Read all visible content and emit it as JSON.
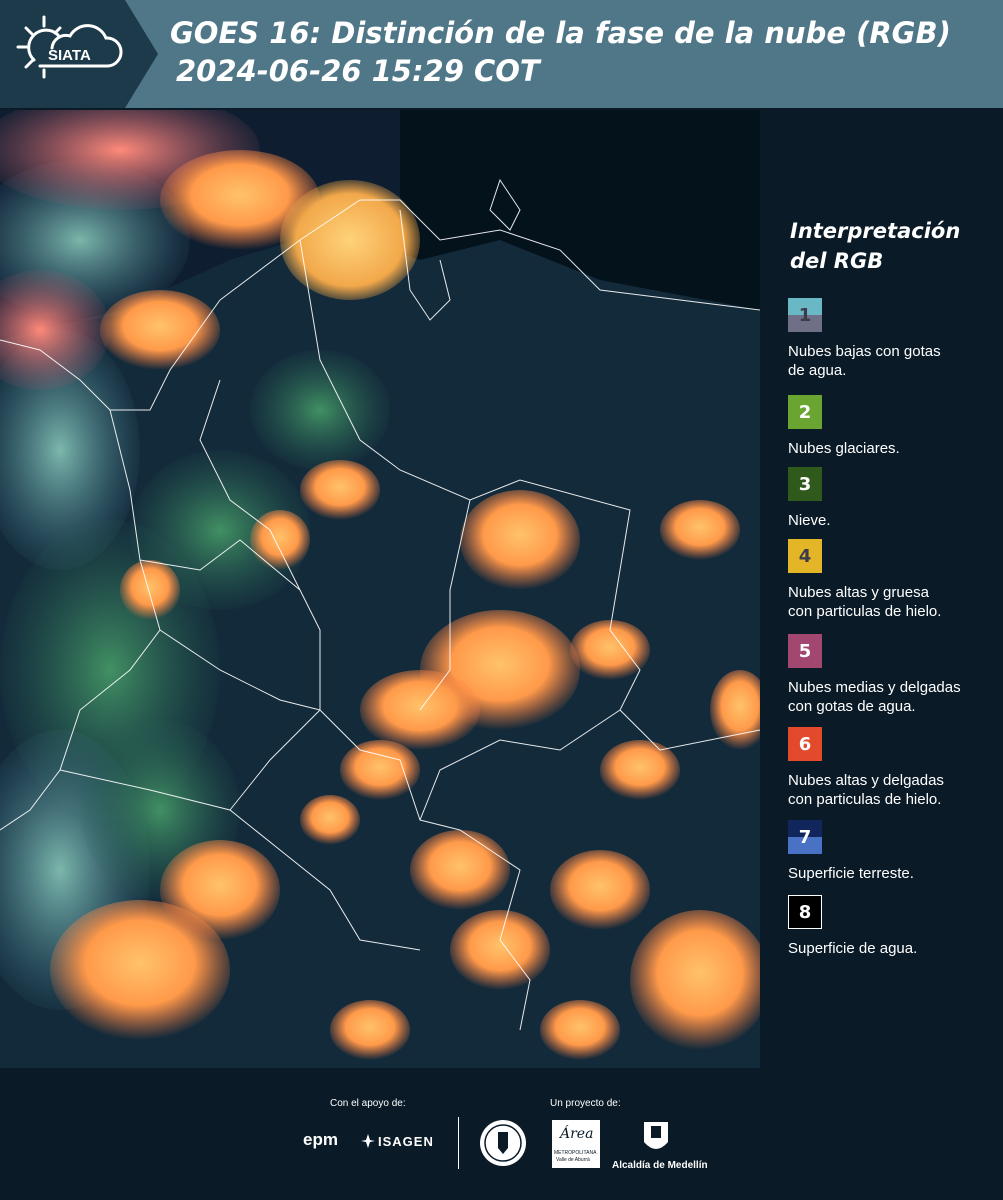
{
  "header": {
    "logo_text": "SIATA",
    "title_line1": "GOES 16: Distinción de la fase de la nube (RGB)",
    "title_line2": "2024-06-26 15:29 COT"
  },
  "legend": {
    "title_line1": "Interpretación",
    "title_line2": "del RGB",
    "items": [
      {
        "number": "1",
        "label_line1": "Nubes bajas con gotas",
        "label_line2": "de agua.",
        "colors": [
          "#6ab8c6",
          "#6f6f88"
        ]
      },
      {
        "number": "2",
        "label_line1": "Nubes glaciares.",
        "label_line2": "",
        "colors": [
          "#6aa531"
        ]
      },
      {
        "number": "3",
        "label_line1": "Nieve.",
        "label_line2": "",
        "colors": [
          "#2f5a1c"
        ]
      },
      {
        "number": "4",
        "label_line1": "Nubes altas y gruesa",
        "label_line2": "con particulas de hielo.",
        "colors": [
          "#e4b526"
        ]
      },
      {
        "number": "5",
        "label_line1": "Nubes medias y delgadas",
        "label_line2": "con gotas de agua.",
        "colors": [
          "#a2476f"
        ]
      },
      {
        "number": "6",
        "label_line1": "Nubes altas y delgadas",
        "label_line2": "con particulas de hielo.",
        "colors": [
          "#e24a2b"
        ]
      },
      {
        "number": "7",
        "label_line1": "Superficie terreste.",
        "label_line2": "",
        "colors": [
          "#12265e",
          "#4a72c4"
        ]
      },
      {
        "number": "8",
        "label_line1": "Superficie de agua.",
        "label_line2": "",
        "colors": [
          "#000000"
        ]
      }
    ]
  },
  "footer": {
    "support_label": "Con el apoyo de:",
    "project_label": "Un proyecto de:",
    "sponsor1": "epm",
    "sponsor2": "ISAGEN",
    "partner1_line1": "METROPOLITANA",
    "partner1_line2": "Valle de Aburrá",
    "partner1_script": "Área",
    "partner2": "Alcaldía de Medellín"
  }
}
